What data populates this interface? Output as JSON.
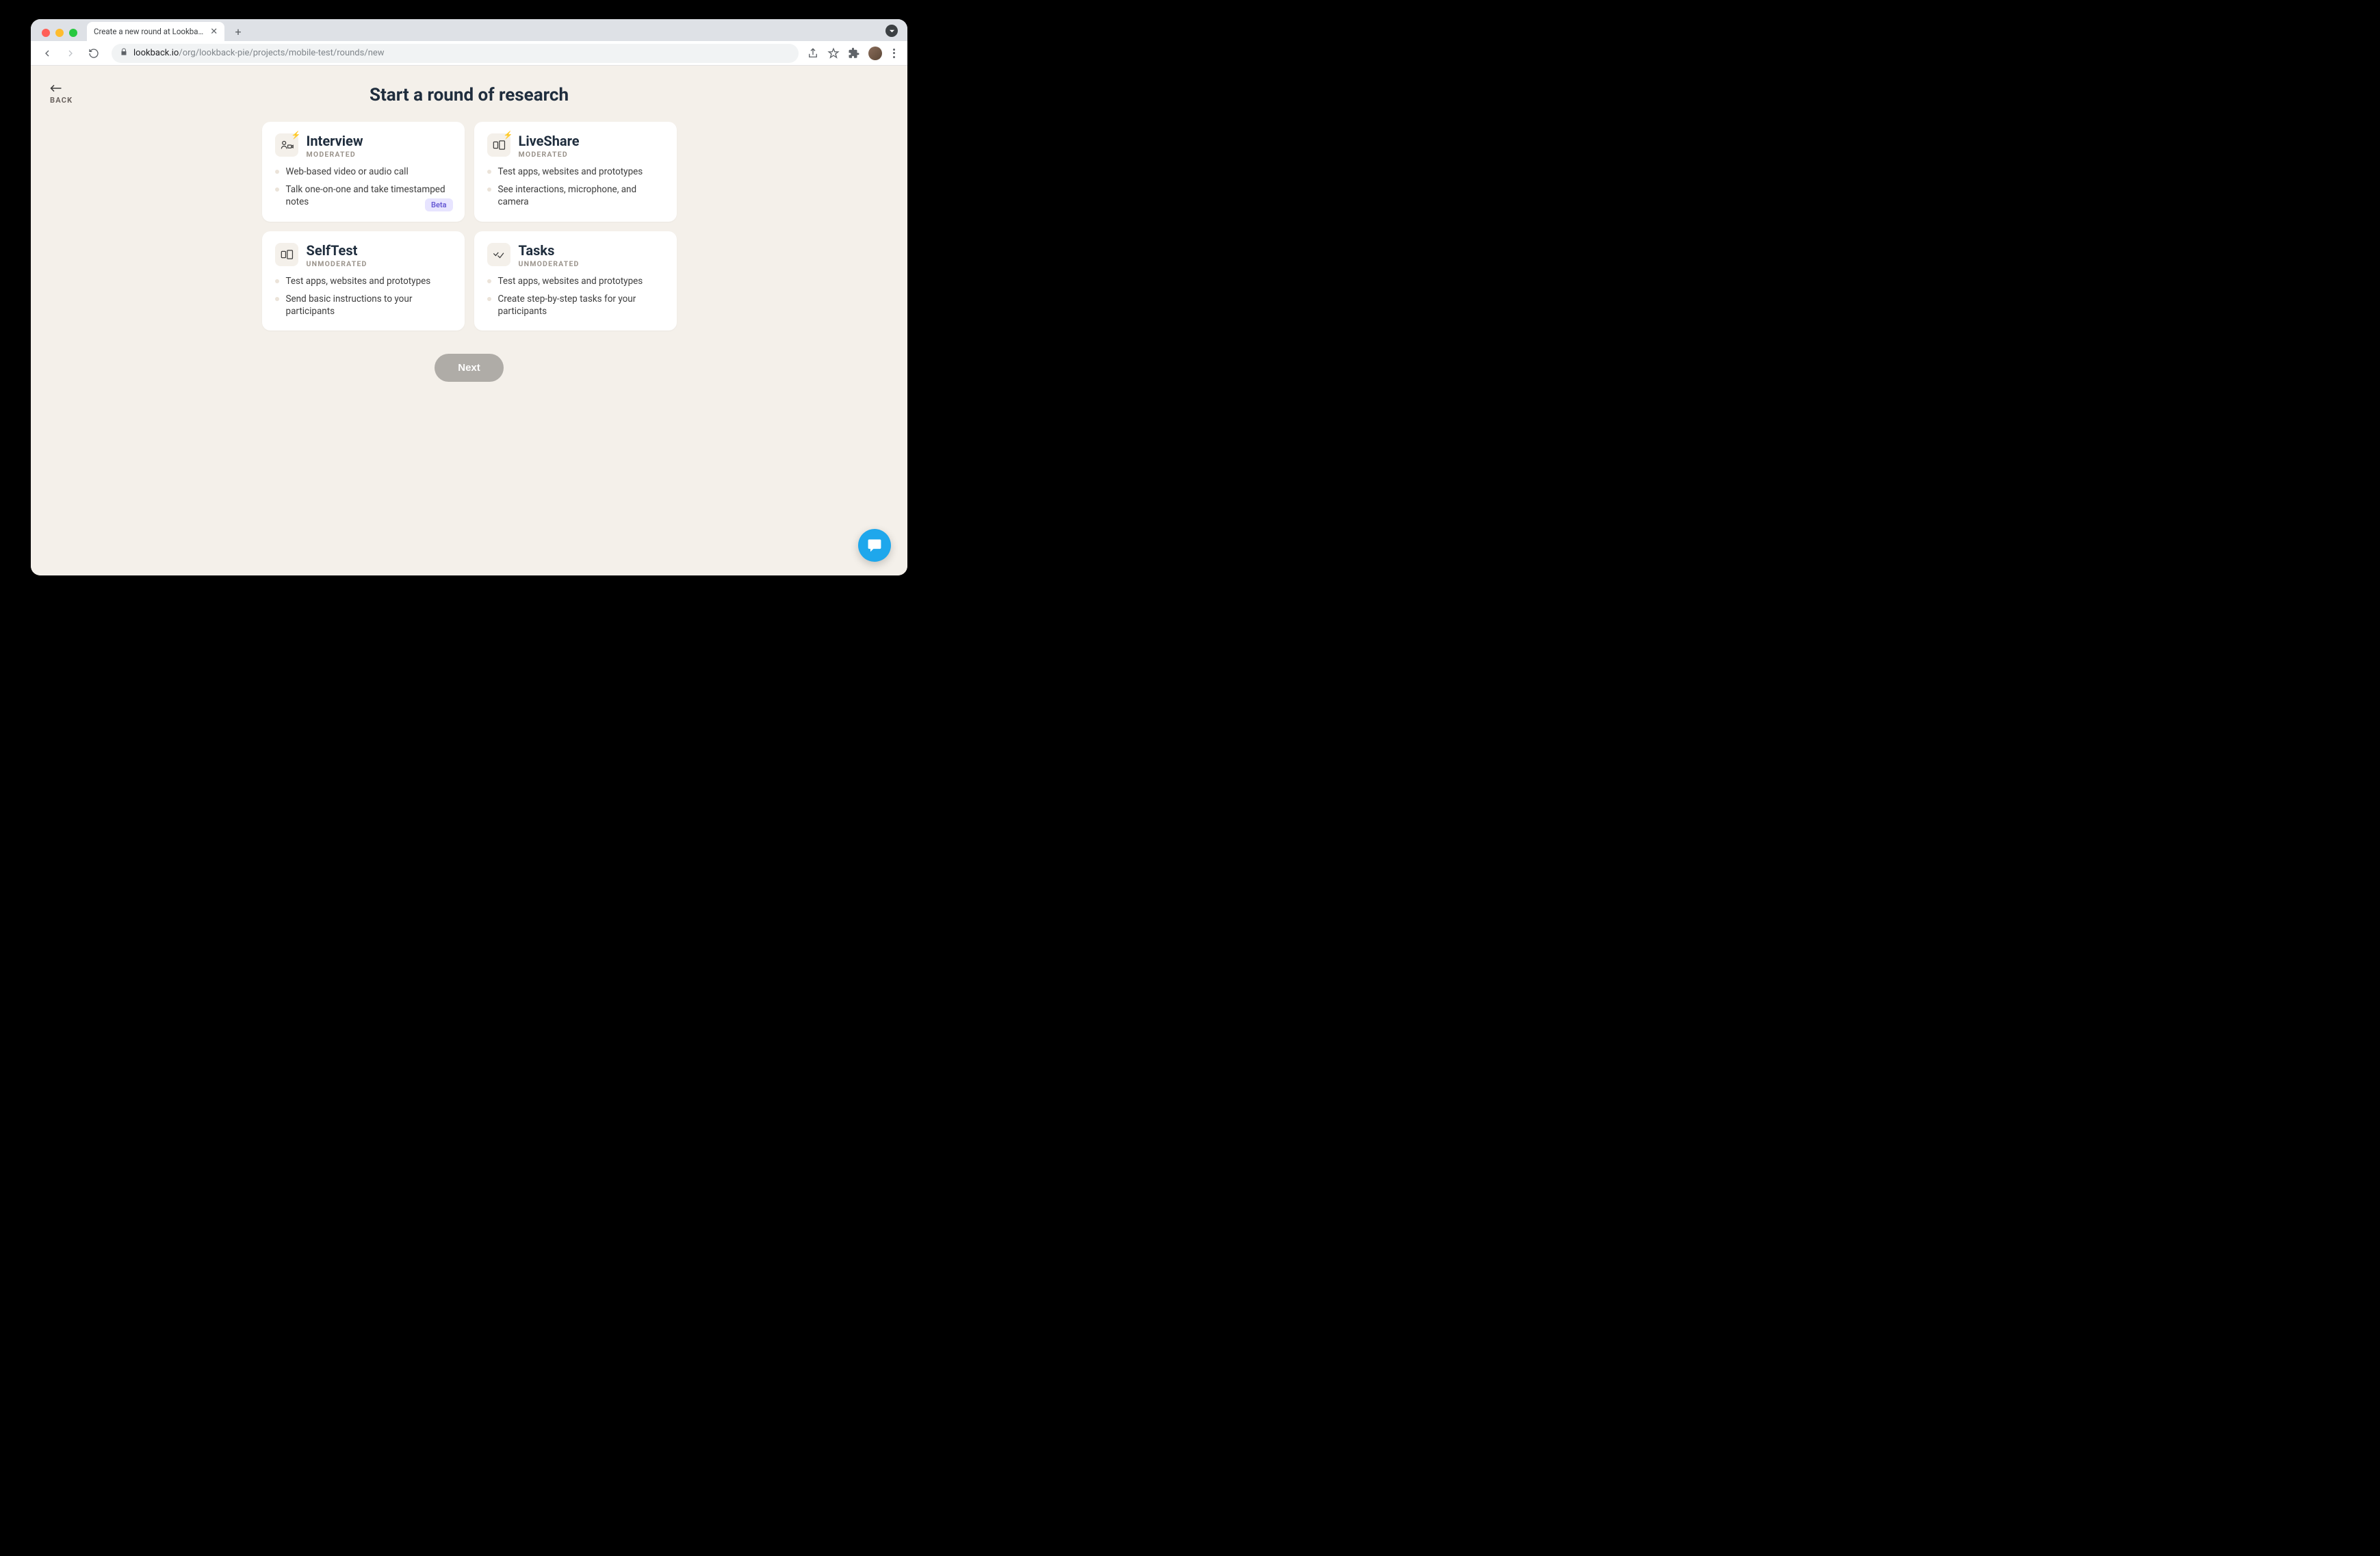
{
  "browser": {
    "tab_title": "Create a new round at Lookba…",
    "url_host": "lookback.io",
    "url_path": "/org/lookback-pie/projects/mobile-test/rounds/new"
  },
  "page": {
    "back_label": "BACK",
    "title": "Start a round of research",
    "next_button": "Next"
  },
  "cards": {
    "interview": {
      "title": "Interview",
      "subtitle": "MODERATED",
      "bullets": [
        "Web-based video or audio call",
        "Talk one-on-one and take timestamped notes"
      ],
      "badge": "Beta"
    },
    "liveshare": {
      "title": "LiveShare",
      "subtitle": "MODERATED",
      "bullets": [
        "Test apps, websites and prototypes",
        "See interactions, microphone, and camera"
      ]
    },
    "selftest": {
      "title": "SelfTest",
      "subtitle": "UNMODERATED",
      "bullets": [
        "Test apps, websites and prototypes",
        "Send basic instructions to your participants"
      ]
    },
    "tasks": {
      "title": "Tasks",
      "subtitle": "UNMODERATED",
      "bullets": [
        "Test apps, websites and prototypes",
        "Create step-by-step tasks for your participants"
      ]
    }
  }
}
